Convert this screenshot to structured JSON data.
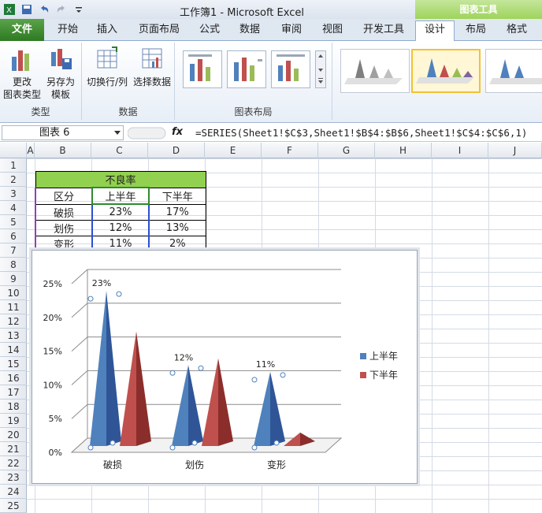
{
  "window": {
    "title": "工作簿1 - Microsoft Excel",
    "tools_header": "图表工具"
  },
  "tabs": [
    "文件",
    "开始",
    "插入",
    "页面布局",
    "公式",
    "数据",
    "审阅",
    "视图",
    "开发工具",
    "设计",
    "布局",
    "格式"
  ],
  "ribbon": {
    "groups": [
      {
        "label": "类型",
        "buttons": [
          "更改\n图表类型",
          "另存为\n模板"
        ]
      },
      {
        "label": "数据",
        "buttons": [
          "切换行/列",
          "选择数据"
        ]
      },
      {
        "label": "图表布局"
      }
    ]
  },
  "formula_bar": {
    "name_box": "图表 6",
    "fx": "fx",
    "formula": "=SERIES(Sheet1!$C$3,Sheet1!$B$4:$B$6,Sheet1!$C$4:$C$6,1)"
  },
  "columns": [
    "A",
    "B",
    "C",
    "D",
    "E",
    "F",
    "G",
    "H",
    "I",
    "J"
  ],
  "rows": [
    "1",
    "2",
    "3",
    "4",
    "5",
    "6",
    "7",
    "8",
    "9",
    "10",
    "11",
    "12",
    "13",
    "14",
    "15",
    "16",
    "17",
    "18",
    "19",
    "20",
    "21",
    "22",
    "23",
    "24",
    "25"
  ],
  "table": {
    "title": "不良率",
    "headers": [
      "区分",
      "上半年",
      "下半年"
    ],
    "rows": [
      [
        "破损",
        "23%",
        "17%"
      ],
      [
        "划伤",
        "12%",
        "13%"
      ],
      [
        "变形",
        "11%",
        "2%"
      ]
    ]
  },
  "colors": {
    "series1": "#4f81bd",
    "series2": "#c0504d",
    "header_fill": "#92d050"
  },
  "chart_data": {
    "type": "bar",
    "style": "3d-pyramid",
    "categories": [
      "破损",
      "划伤",
      "变形"
    ],
    "series": [
      {
        "name": "上半年",
        "values": [
          23,
          12,
          11
        ],
        "color": "#4f81bd"
      },
      {
        "name": "下半年",
        "values": [
          17,
          13,
          2
        ],
        "color": "#c0504d"
      }
    ],
    "data_labels": [
      "23%",
      "12%",
      "11%"
    ],
    "yticks": [
      "0%",
      "5%",
      "10%",
      "15%",
      "20%",
      "25%"
    ],
    "ylim": [
      0,
      25
    ],
    "legend": "right",
    "grid": true
  }
}
